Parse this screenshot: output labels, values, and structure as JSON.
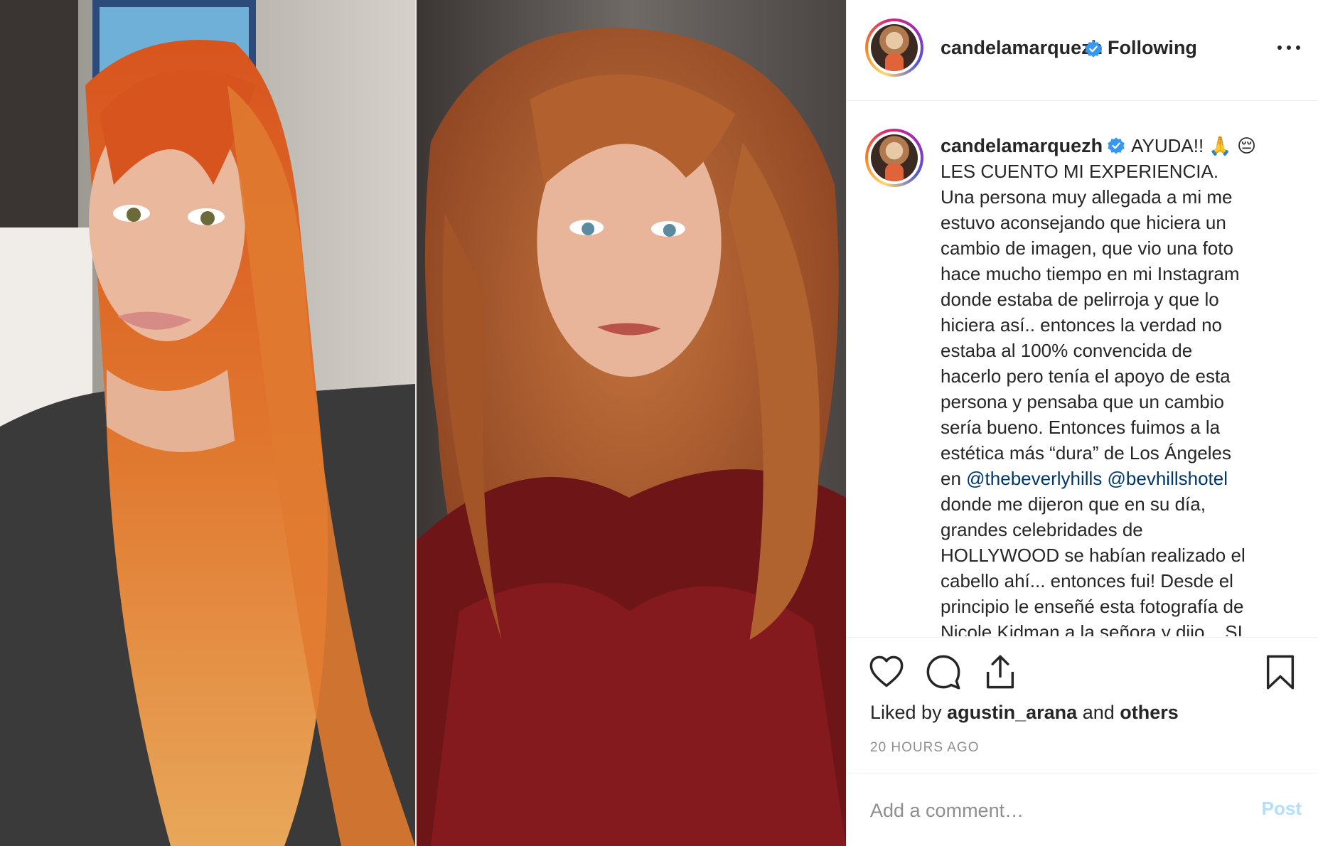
{
  "header": {
    "username": "candelamarquezh",
    "follow_status": "• Following",
    "more_icon": "more-horizontal-icon"
  },
  "caption": {
    "username": "candelamarquezh",
    "lines": [
      "AYUDA!! 🙏 😔",
      "LES CUENTO MI EXPERIENCIA.",
      "Una persona muy allegada a mi me",
      "estuvo aconsejando que hiciera un",
      "cambio de imagen, que vio una foto",
      "hace mucho tiempo en mi Instagram",
      "donde estaba de pelirroja y que lo",
      "hiciera así.. entonces la verdad no",
      "estaba al 100% convencida de",
      "hacerlo pero tenía el apoyo de esta",
      "persona y pensaba que un cambio",
      "sería bueno. Entonces fuimos a la",
      "estética más “dura” de Los Ángeles"
    ],
    "mention_prefix": "en ",
    "mention_1": "@thebeverlyhills",
    "mention_2": "@bevhillshotel",
    "lines_after": [
      "donde me dijeron que en su día,",
      "grandes celebridades de",
      "HOLLYWOOD se habían realizado el",
      "cabello ahí... entonces fui! Desde el",
      "principio le enseñé esta fotografía de",
      "Nicole Kidman a la señora y dijo... SI"
    ]
  },
  "actions": {
    "like_icon": "heart-icon",
    "comment_icon": "comment-icon",
    "share_icon": "share-icon",
    "save_icon": "bookmark-icon"
  },
  "likes": {
    "prefix": "Liked by",
    "user": "agustin_arana",
    "middle": "and",
    "others": "others"
  },
  "timestamp": "20 HOURS AGO",
  "comment": {
    "placeholder": "Add a comment…",
    "post_label": "Post"
  },
  "colors": {
    "verified": "#3897f0",
    "mention": "#00376b",
    "post_disabled": "#b2dffc",
    "muted": "#8e8e8e"
  }
}
